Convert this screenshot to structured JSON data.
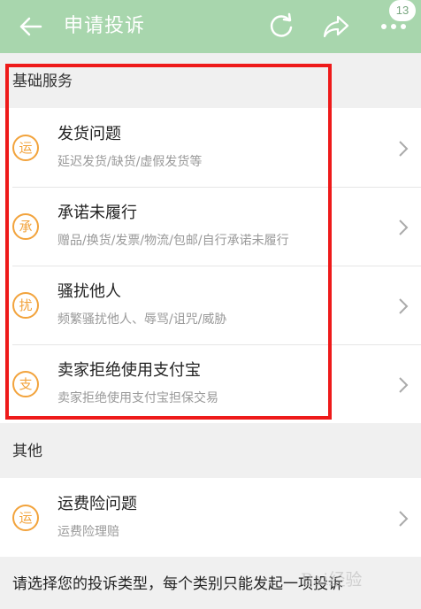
{
  "header": {
    "title": "申请投诉",
    "notification_count": "13",
    "color": "#a8d6ad"
  },
  "sections": [
    {
      "label": "基础服务",
      "items": [
        {
          "icon_char": "运",
          "title": "发货问题",
          "subtitle": "延迟发货/缺货/虚假发货等"
        },
        {
          "icon_char": "承",
          "title": "承诺未履行",
          "subtitle": "赠品/换货/发票/物流/包邮/自行承诺未履行"
        },
        {
          "icon_char": "扰",
          "title": "骚扰他人",
          "subtitle": "频繁骚扰他人、辱骂/诅咒/威胁"
        },
        {
          "icon_char": "支",
          "title": "卖家拒绝使用支付宝",
          "subtitle": "卖家拒绝使用支付宝担保交易"
        }
      ]
    },
    {
      "label": "其他",
      "items": [
        {
          "icon_char": "运",
          "title": "运费险问题",
          "subtitle": "运费险理赔"
        }
      ]
    }
  ],
  "footer": {
    "text": "请选择您的投诉类型，每个类别只能发起一项投诉"
  },
  "watermark": "Bai经验",
  "colors": {
    "accent": "#f2a33c",
    "highlight": "#ee1a1a"
  }
}
